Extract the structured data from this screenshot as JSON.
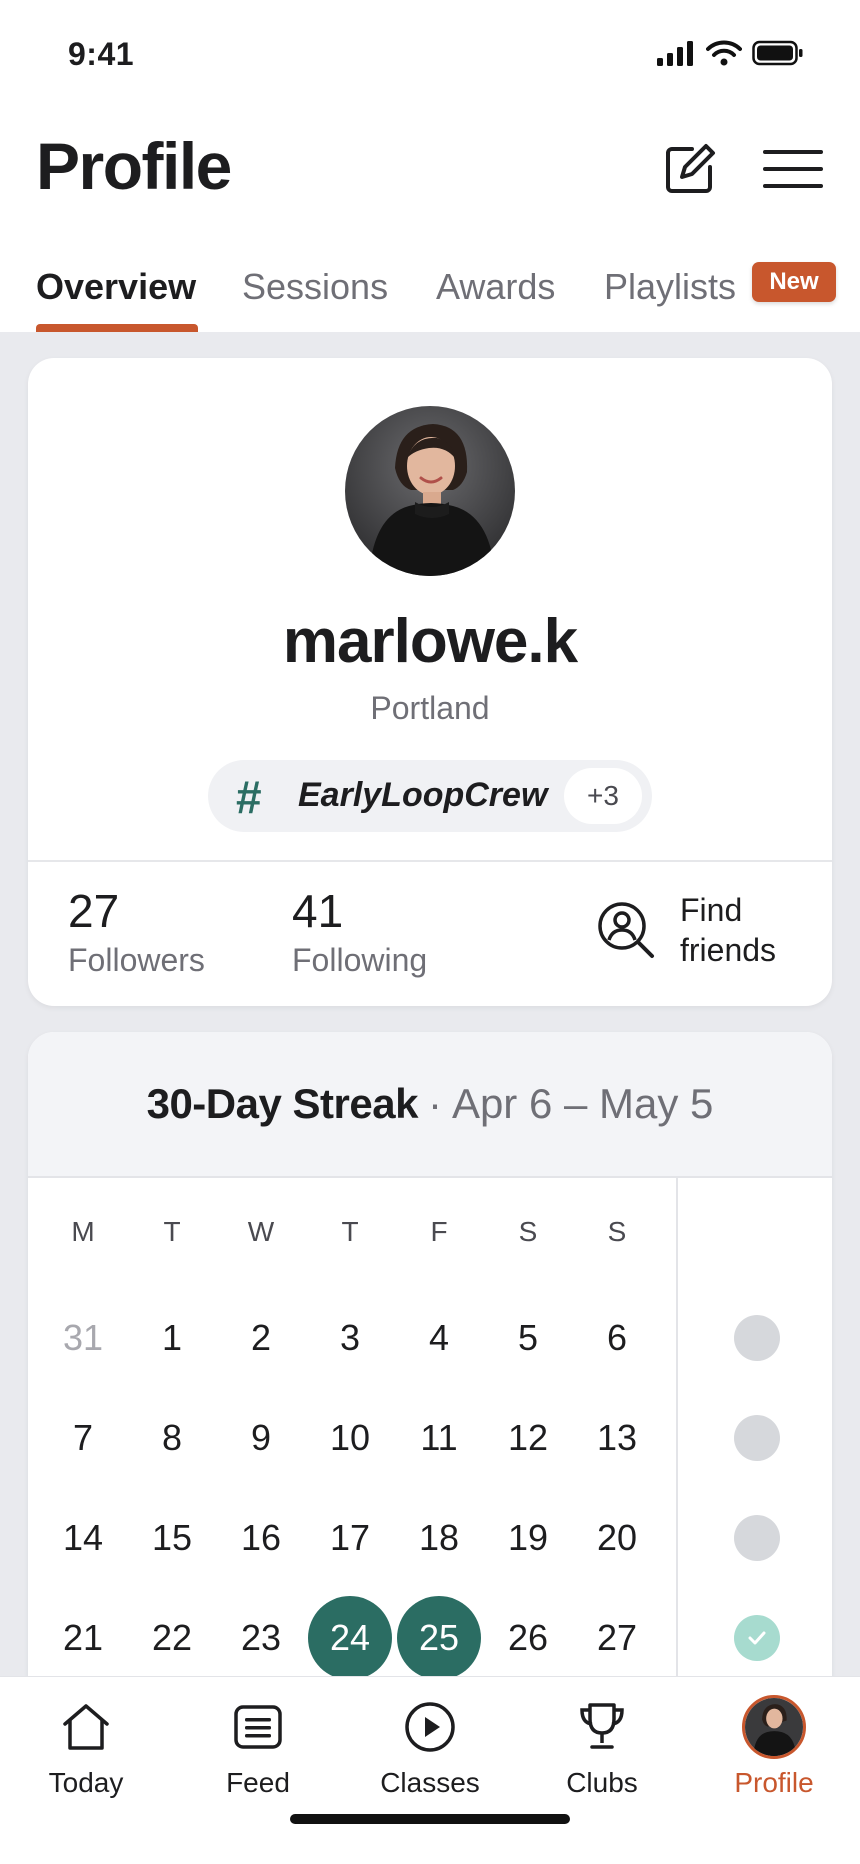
{
  "status_bar": {
    "time": "9:41"
  },
  "header": {
    "title": "Profile",
    "edit_icon": "compose-icon",
    "menu_icon": "hamburger-menu-icon"
  },
  "tabs": [
    {
      "label": "Overview",
      "active": true
    },
    {
      "label": "Sessions",
      "active": false
    },
    {
      "label": "Awards",
      "active": false
    },
    {
      "label": "Playlists",
      "active": false,
      "badge": "New"
    }
  ],
  "profile": {
    "username": "marlowe.k",
    "location": "Portland",
    "tag": {
      "symbol": "#",
      "name": "EarlyLoopCrew",
      "more": "+3"
    },
    "stats": [
      {
        "value": "27",
        "label": "Followers"
      },
      {
        "value": "41",
        "label": "Following"
      }
    ],
    "find_friends": {
      "line1": "Find",
      "line2": "friends"
    }
  },
  "streak": {
    "title": "30-Day Streak",
    "separator": "·",
    "range": "Apr 6 – May 5",
    "weekdays": [
      "M",
      "T",
      "W",
      "T",
      "F",
      "S",
      "S"
    ],
    "weeks": [
      {
        "days": [
          "31",
          "1",
          "2",
          "3",
          "4",
          "5",
          "6"
        ],
        "complete": false
      },
      {
        "days": [
          "7",
          "8",
          "9",
          "10",
          "11",
          "12",
          "13"
        ],
        "complete": false
      },
      {
        "days": [
          "14",
          "15",
          "16",
          "17",
          "18",
          "19",
          "20"
        ],
        "complete": false
      },
      {
        "days": [
          "21",
          "22",
          "23",
          "24",
          "25",
          "26",
          "27"
        ],
        "complete": true
      }
    ],
    "active_days": [
      "24",
      "25"
    ],
    "muted_days": [
      "31"
    ],
    "colors": {
      "active": "#2b6d63",
      "accent": "#c8572d"
    }
  },
  "bottom_nav": [
    {
      "label": "Today",
      "icon": "home-icon"
    },
    {
      "label": "Feed",
      "icon": "feed-icon"
    },
    {
      "label": "Classes",
      "icon": "play-circle-icon"
    },
    {
      "label": "Clubs",
      "icon": "trophy-icon"
    },
    {
      "label": "Profile",
      "icon": "avatar",
      "active": true
    }
  ]
}
